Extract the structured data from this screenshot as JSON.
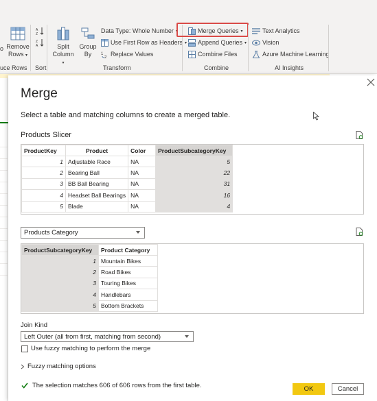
{
  "ribbon": {
    "reduce_rows": {
      "remove_rows_line1": "Remove",
      "remove_rows_line2": "Rows",
      "group_label": "uce Rows",
      "left_partial": "o"
    },
    "sort": {
      "group_label": "Sort"
    },
    "transform": {
      "split_column_line1": "Split",
      "split_column_line2": "Column",
      "group_by_line1": "Group",
      "group_by_line2": "By",
      "data_type": "Data Type: Whole Number",
      "use_first_row": "Use First Row as Headers",
      "replace_values": "Replace Values",
      "group_label": "Transform"
    },
    "combine": {
      "merge_queries": "Merge Queries",
      "append_queries": "Append Queries",
      "combine_files": "Combine Files",
      "group_label": "Combine"
    },
    "ai_insights": {
      "text_analytics": "Text Analytics",
      "vision": "Vision",
      "azure_ml": "Azure Machine Learning",
      "group_label": "AI Insights"
    }
  },
  "dialog": {
    "title": "Merge",
    "subtitle": "Select a table and matching columns to create a merged table.",
    "first_table": {
      "name": "Products Slicer",
      "columns": [
        "ProductKey",
        "Product",
        "Color",
        "ProductSubcategoryKey"
      ],
      "rows": [
        [
          "1",
          "Adjustable Race",
          "NA",
          "5"
        ],
        [
          "2",
          "Bearing Ball",
          "NA",
          "22"
        ],
        [
          "3",
          "BB Ball Bearing",
          "NA",
          "31"
        ],
        [
          "4",
          "Headset Ball Bearings",
          "NA",
          "16"
        ],
        [
          "5",
          "Blade",
          "NA",
          "4"
        ]
      ]
    },
    "second_table": {
      "selected": "Products Category",
      "columns": [
        "ProductSubcategoryKey",
        "Product Category"
      ],
      "rows": [
        [
          "1",
          "Mountain Bikes"
        ],
        [
          "2",
          "Road Bikes"
        ],
        [
          "3",
          "Touring Bikes"
        ],
        [
          "4",
          "Handlebars"
        ],
        [
          "5",
          "Bottom Brackets"
        ]
      ]
    },
    "join_kind": {
      "label": "Join Kind",
      "selected": "Left Outer (all from first, matching from second)"
    },
    "fuzzy_checkbox_label": "Use fuzzy matching to perform the merge",
    "fuzzy_options_label": "Fuzzy matching options",
    "status": "The selection matches 606 of 606 rows from the first table.",
    "ok": "OK",
    "cancel": "Cancel"
  },
  "colors": {
    "accent_yellow": "#f2c811",
    "highlight_red": "#d94a47",
    "success_green": "#107c10"
  }
}
